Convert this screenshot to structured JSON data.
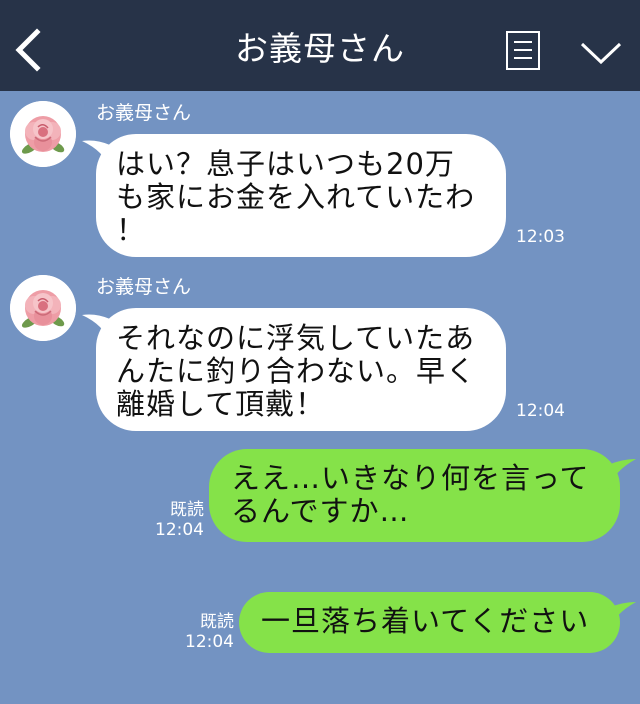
{
  "header": {
    "title": "お義母さん",
    "background": "#273348",
    "icons": [
      "chevron-left-icon",
      "menu-icon",
      "chevron-down-icon"
    ]
  },
  "chat": {
    "background": "#7393c2",
    "messages": [
      {
        "direction": "incoming",
        "sender": "お義母さん",
        "lines": [
          "はい？息子はいつも20万",
          "も家にお金を入れていたわ",
          "！"
        ],
        "time": "12:03",
        "avatar_icon": "rose-icon"
      },
      {
        "direction": "incoming",
        "sender": "お義母さん",
        "lines": [
          "それなのに浮気していたあ",
          "んたに釣り合わない。早く",
          "離婚して頂戴！"
        ],
        "time": "12:04",
        "avatar_icon": "rose-icon"
      },
      {
        "direction": "outgoing",
        "read_label": "既読",
        "time": "12:04",
        "lines": [
          "ええ…いきなり何を言って",
          "るんですか…"
        ]
      },
      {
        "direction": "outgoing",
        "read_label": "既読",
        "time": "12:04",
        "lines": [
          "一旦落ち着いてください"
        ]
      }
    ]
  },
  "colors": {
    "incoming_bubble": "#ffffff",
    "outgoing_bubble": "#85e249",
    "text": "#111111"
  }
}
